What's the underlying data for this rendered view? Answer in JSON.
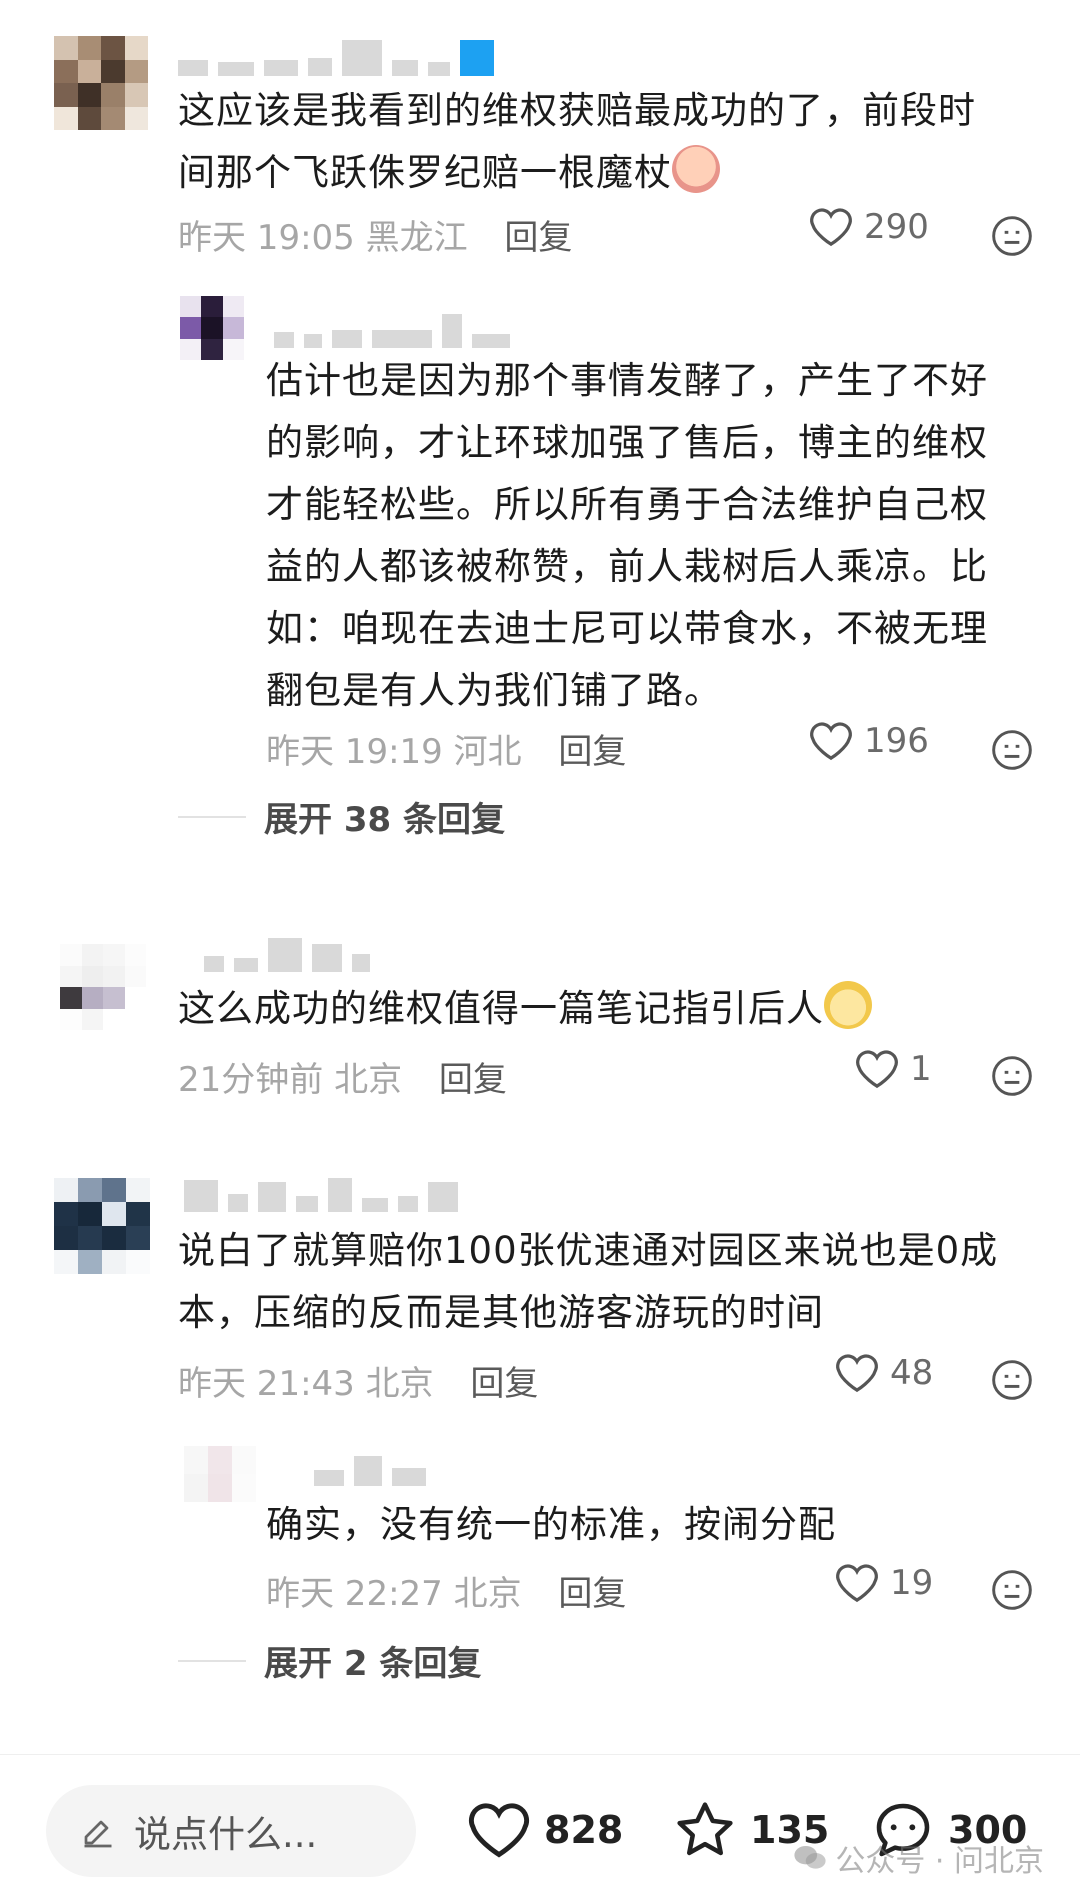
{
  "comments": [
    {
      "text_line1": "这应该是我看到的维权获赔最成功的了，前段时",
      "text_line2": "间那个飞跃侏罗纪赔一根魔杖",
      "emoji_icon": "crying-face-emoji",
      "time": "昨天 19:05",
      "location": "黑龙江",
      "reply_label": "回复",
      "likes": "290",
      "reply": {
        "lines": [
          "估计也是因为那个事情发酵了，产生了不好",
          "的影响，才让环球加强了售后，博主的维权",
          "才能轻松些。所以所有勇于合法维护自己权",
          "益的人都该被称赞，前人栽树后人乘凉。比",
          "如：咱现在去迪士尼可以带食水，不被无理",
          "翻包是有人为我们铺了路。"
        ],
        "time": "昨天 19:19",
        "location": "河北",
        "reply_label": "回复",
        "likes": "196"
      },
      "expand_label": "展开 38 条回复"
    },
    {
      "text_line1": "这么成功的维权值得一篇笔记指引后人",
      "emoji_icon": "pear-face-emoji",
      "time": "21分钟前",
      "location": "北京",
      "reply_label": "回复",
      "likes": "1"
    },
    {
      "text_line1": "说白了就算赔你100张优速通对园区来说也是0成",
      "text_line2": "本，压缩的反而是其他游客游玩的时间",
      "time": "昨天 21:43",
      "location": "北京",
      "reply_label": "回复",
      "likes": "48",
      "reply": {
        "lines": [
          "确实，没有统一的标准，按闹分配"
        ],
        "time": "昨天 22:27",
        "location": "北京",
        "reply_label": "回复",
        "likes": "19"
      },
      "expand_label": "展开 2 条回复"
    }
  ],
  "bottom_bar": {
    "input_placeholder": "说点什么...",
    "likes_count": "828",
    "stars_count": "135",
    "comments_count": "300"
  },
  "watermark": "公众号 · 问北京",
  "colors": {
    "text": "#1c1c1c",
    "meta": "#a6a6a6",
    "mosaic_light": "#d9d9d9"
  }
}
